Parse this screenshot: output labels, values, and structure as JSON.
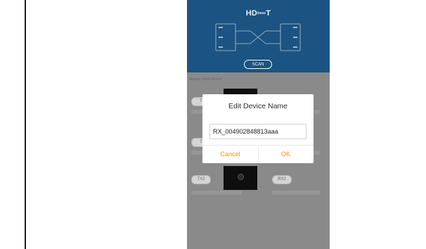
{
  "app": {
    "brand": "HD  T"
  },
  "header": {
    "scan_label": "SCAN"
  },
  "list": {
    "section_label": "Already found device",
    "rows": [
      {
        "tx": "T",
        "rx": ""
      },
      {
        "tx": "T",
        "rx": ""
      },
      {
        "tx": "TX2",
        "rx": "RX2"
      }
    ]
  },
  "dialog": {
    "title": "Edit Device Name",
    "value": "RX_004902848813aaa",
    "cancel_label": "Cancel",
    "ok_label": "OK"
  },
  "colors": {
    "header_bg": "#1c5585",
    "accent": "#ff8a1d",
    "overlay_gray": "#8d8d8d"
  }
}
